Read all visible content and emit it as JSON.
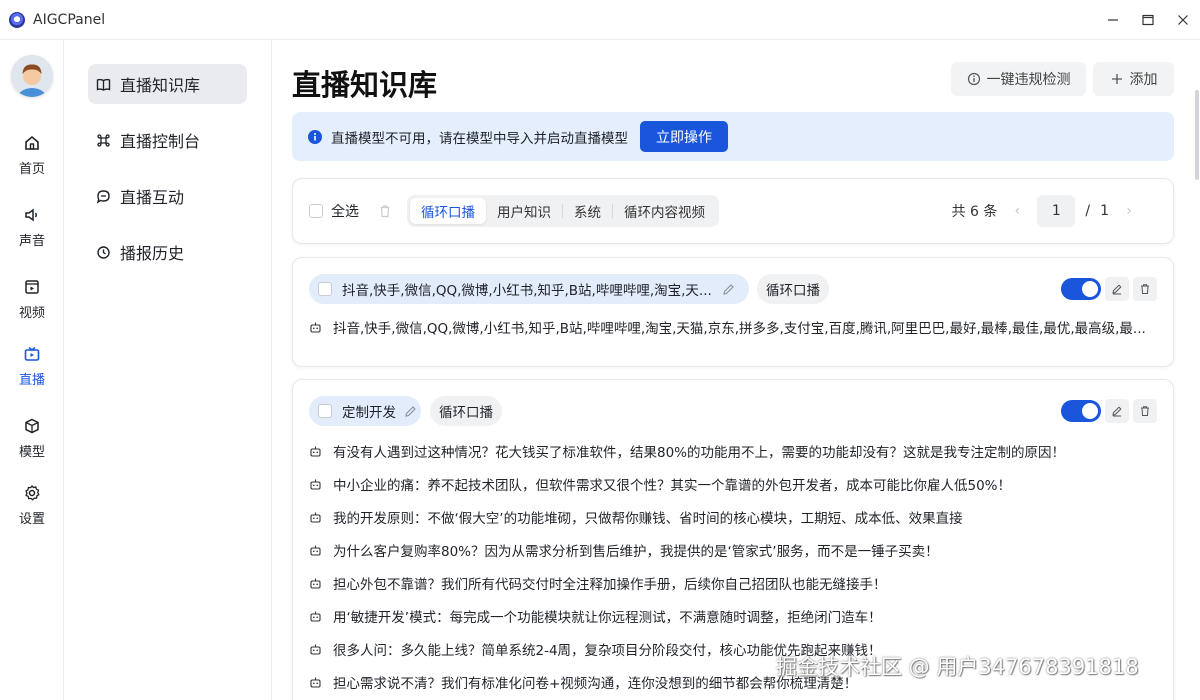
{
  "window": {
    "title": "AIGCPanel"
  },
  "nav": {
    "items": [
      {
        "label": "首页",
        "icon": "home-icon"
      },
      {
        "label": "声音",
        "icon": "speaker-icon"
      },
      {
        "label": "视频",
        "icon": "video-icon"
      },
      {
        "label": "直播",
        "icon": "live-tv-icon",
        "active": true
      },
      {
        "label": "模型",
        "icon": "cube-icon"
      },
      {
        "label": "设置",
        "icon": "gear-icon"
      }
    ]
  },
  "subnav": {
    "items": [
      {
        "label": "直播知识库",
        "icon": "book-icon",
        "active": true
      },
      {
        "label": "直播控制台",
        "icon": "command-icon"
      },
      {
        "label": "直播互动",
        "icon": "chat-icon"
      },
      {
        "label": "播报历史",
        "icon": "history-icon"
      }
    ]
  },
  "page": {
    "title": "直播知识库",
    "check_btn": "一键违规检测",
    "add_btn": "添加"
  },
  "notice": {
    "text": "直播模型不可用，请在模型中导入并启动直播模型",
    "action": "立即操作"
  },
  "toolbar": {
    "select_all": "全选",
    "tabs": [
      "循环口播",
      "用户知识",
      "系统",
      "循环内容视频"
    ],
    "active_tab": "循环口播",
    "total": "共 6 条",
    "page": "1",
    "slash": "/",
    "total_pages": "1"
  },
  "entries": [
    {
      "title": "抖音,快手,微信,QQ,微博,小红书,知乎,B站,哔哩哔哩,淘宝,天...",
      "tag": "循环口播",
      "enabled": true,
      "lines": [
        "抖音,快手,微信,QQ,微博,小红书,知乎,B站,哔哩哔哩,淘宝,天猫,京东,拼多多,支付宝,百度,腾讯,阿里巴巴,最好,最棒,最佳,最优,最高级,最..."
      ]
    },
    {
      "title": "定制开发",
      "tag": "循环口播",
      "enabled": true,
      "lines": [
        "有没有人遇到过这种情况？花大钱买了标准软件，结果80%的功能用不上，需要的功能却没有？这就是我专注定制的原因！",
        "中小企业的痛：养不起技术团队，但软件需求又很个性？其实一个靠谱的外包开发者，成本可能比你雇人低50%！",
        "我的开发原则：不做‘假大空’的功能堆砌，只做帮你赚钱、省时间的核心模块，工期短、成本低、效果直接",
        "为什么客户复购率80%？因为从需求分析到售后维护，我提供的是‘管家式’服务，而不是一锤子买卖！",
        "担心外包不靠谱？我们所有代码交付时全注释加操作手册，后续你自己招团队也能无缝接手！",
        "用‘敏捷开发’模式：每完成一个功能模块就让你远程测试，不满意随时调整，拒绝闭门造车！",
        "很多人问：多久能上线？简单系统2-4周，复杂项目分阶段交付，核心功能优先跑起来赚钱！",
        "担心需求说不清？我们有标准化问卷+视频沟通，连你没想到的细节都会帮你梳理清楚！"
      ]
    }
  ],
  "watermark": "掘金技术社区 @ 用户347678391818",
  "colors": {
    "accent": "#1a56db",
    "notice_bg": "#e4eefc",
    "chip_bg": "#e3ecfb"
  }
}
